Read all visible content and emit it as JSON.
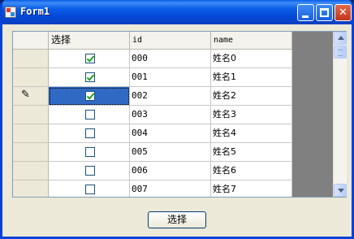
{
  "window": {
    "title": "Form1"
  },
  "grid": {
    "columns": [
      "选择",
      "id",
      "name"
    ],
    "rows": [
      {
        "checked": true,
        "id": "000",
        "name": "姓名0"
      },
      {
        "checked": true,
        "id": "001",
        "name": "姓名1"
      },
      {
        "checked": true,
        "id": "002",
        "name": "姓名2",
        "editing": true
      },
      {
        "checked": false,
        "id": "003",
        "name": "姓名3"
      },
      {
        "checked": false,
        "id": "004",
        "name": "姓名4"
      },
      {
        "checked": false,
        "id": "005",
        "name": "姓名5"
      },
      {
        "checked": false,
        "id": "006",
        "name": "姓名6"
      },
      {
        "checked": false,
        "id": "007",
        "name": "姓名7"
      }
    ]
  },
  "button": {
    "label": "选择"
  },
  "icons": {
    "title_icon": "form-app-icon",
    "edit_row_icon": "pencil-icon"
  },
  "colors": {
    "title_bar": "#0347d6",
    "selection": "#316ac5",
    "grid_background": "#808080"
  }
}
